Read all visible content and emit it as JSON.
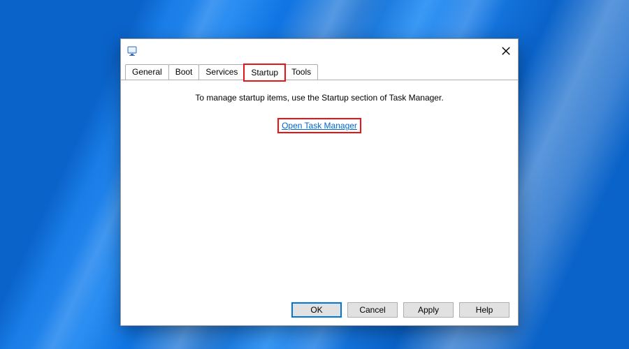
{
  "tabs": {
    "items": [
      {
        "label": "General"
      },
      {
        "label": "Boot"
      },
      {
        "label": "Services"
      },
      {
        "label": "Startup"
      },
      {
        "label": "Tools"
      }
    ],
    "activeIndex": 3
  },
  "content": {
    "message": "To manage startup items, use the Startup section of Task Manager.",
    "link_label": "Open Task Manager"
  },
  "buttons": {
    "ok": "OK",
    "cancel": "Cancel",
    "apply": "Apply",
    "help": "Help"
  }
}
